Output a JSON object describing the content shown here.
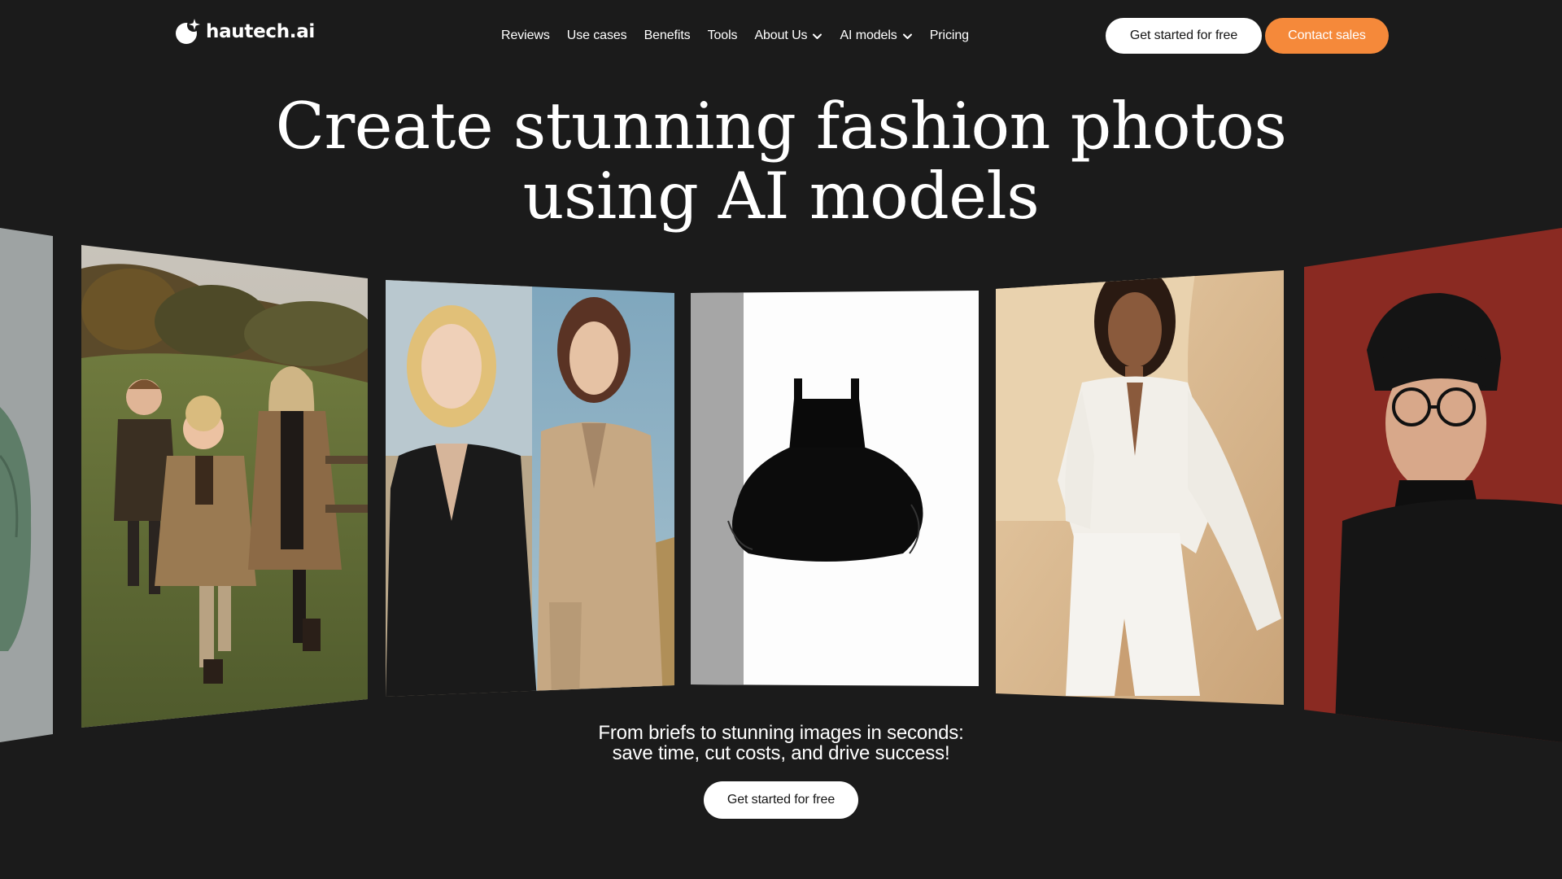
{
  "header": {
    "logo_text": "hautech.ai",
    "nav": [
      {
        "label": "Reviews",
        "dropdown": false
      },
      {
        "label": "Use cases",
        "dropdown": false
      },
      {
        "label": "Benefits",
        "dropdown": false
      },
      {
        "label": "Tools",
        "dropdown": false
      },
      {
        "label": "About Us",
        "dropdown": true
      },
      {
        "label": "AI models",
        "dropdown": true
      },
      {
        "label": "Pricing",
        "dropdown": false
      }
    ],
    "get_started_label": "Get started for free",
    "contact_sales_label": "Contact sales"
  },
  "hero": {
    "title_line1": "Create stunning fashion photos",
    "title_line2": "using AI models",
    "tagline_line1": "From briefs to stunning images in seconds:",
    "tagline_line2": "save time, cut costs, and drive success!",
    "cta_label": "Get started for free"
  },
  "gallery": {
    "cards": [
      {
        "subject": "green puffer jacket on grey backdrop"
      },
      {
        "subject": "three children in brown coats running on grassy hill"
      },
      {
        "subject": "two women in black and beige blazers"
      },
      {
        "subject": "black tutu dress on white background"
      },
      {
        "subject": "woman in white blouse and skirt in desert"
      },
      {
        "subject": "man with glasses in black turtleneck on red backdrop"
      }
    ]
  },
  "colors": {
    "background": "#1b1b1b",
    "accent_orange": "#f5893a",
    "button_white": "#ffffff"
  }
}
